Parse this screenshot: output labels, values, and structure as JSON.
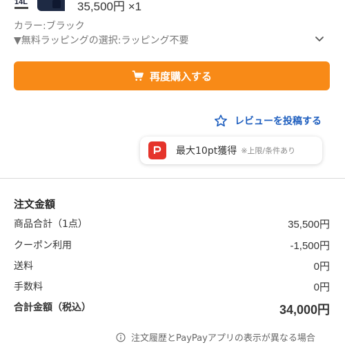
{
  "item": {
    "thumb_badge": "14L",
    "price_qty": "35,500円 ×1",
    "color": "カラー:ブラック",
    "wrapping": "▼無料ラッピングの選択:ラッピング不要"
  },
  "actions": {
    "rebuy_label": "再度購入する",
    "review_label": "レビューを投稿する"
  },
  "points": {
    "main": "最大10pt獲得",
    "note": "※上限/条件あり"
  },
  "summary": {
    "title": "注文金額",
    "rows": [
      {
        "label": "商品合計（1点）",
        "value": "35,500円"
      },
      {
        "label": "クーポン利用",
        "value": "-1,500円"
      },
      {
        "label": "送料",
        "value": "0円"
      },
      {
        "label": "手数料",
        "value": "0円"
      }
    ],
    "total": {
      "label": "合計金額（税込）",
      "value": "34,000円"
    }
  },
  "footer_note": "注文履歴とPayPayアプリの表示が異なる場合",
  "colors": {
    "accent_orange": "#f88a17",
    "link_blue": "#1f5fbf",
    "paypay_red": "#e5342b"
  }
}
